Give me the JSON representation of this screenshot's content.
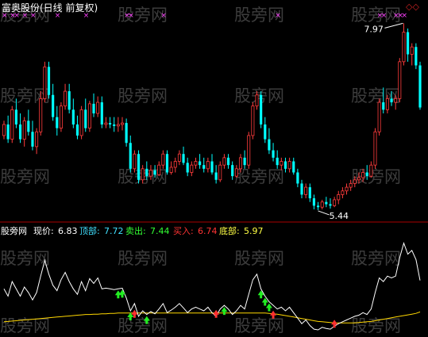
{
  "title": "富奥股份(日线 前复权)",
  "indicator": {
    "name": "股旁网",
    "items": [
      {
        "label": "现价:",
        "value": "6.83",
        "color": "#ffffff"
      },
      {
        "label": "顶部:",
        "value": "7.72",
        "color": "#40e0ff"
      },
      {
        "label": "卖出:",
        "value": "7.44",
        "color": "#33ff33"
      },
      {
        "label": "买入:",
        "value": "6.74",
        "color": "#ff3333"
      },
      {
        "label": "底部:",
        "value": "5.97",
        "color": "#ffff44"
      }
    ]
  },
  "watermark": "股旁网",
  "marker_glyph": "×",
  "top_right_marks": "◇◇",
  "colors": {
    "up": "#ff3c3c",
    "down": "#00ffff",
    "price_line": "#ffffff",
    "bottom_line": "#ffd700",
    "sell_arrow": "#22ee22",
    "buy_arrow": "#ff3030"
  },
  "chart_data": {
    "type": "candlestick",
    "candles": [
      [
        6.45,
        6.65,
        6.4,
        6.6
      ],
      [
        6.6,
        6.72,
        6.35,
        6.4
      ],
      [
        6.4,
        6.85,
        6.35,
        6.8
      ],
      [
        6.8,
        6.95,
        6.55,
        6.6
      ],
      [
        6.6,
        6.75,
        6.35,
        6.4
      ],
      [
        6.4,
        6.7,
        6.3,
        6.65
      ],
      [
        6.65,
        6.8,
        6.45,
        6.5
      ],
      [
        6.5,
        6.65,
        6.25,
        6.3
      ],
      [
        6.3,
        6.55,
        6.2,
        6.5
      ],
      [
        6.5,
        7.05,
        6.45,
        6.95
      ],
      [
        6.95,
        7.45,
        6.9,
        7.38
      ],
      [
        7.38,
        7.45,
        6.95,
        7.0
      ],
      [
        7.0,
        7.15,
        6.65,
        6.7
      ],
      [
        6.7,
        6.85,
        6.45,
        6.55
      ],
      [
        6.55,
        6.9,
        6.5,
        6.85
      ],
      [
        6.85,
        7.15,
        6.8,
        7.05
      ],
      [
        7.05,
        7.15,
        6.75,
        6.8
      ],
      [
        6.8,
        6.95,
        6.55,
        6.6
      ],
      [
        6.6,
        6.72,
        6.4,
        6.45
      ],
      [
        6.45,
        6.85,
        6.4,
        6.8
      ],
      [
        6.8,
        6.95,
        6.5,
        6.55
      ],
      [
        6.55,
        6.92,
        6.5,
        6.88
      ],
      [
        6.88,
        7.02,
        6.7,
        6.75
      ],
      [
        6.75,
        6.98,
        6.7,
        6.9
      ],
      [
        6.9,
        6.98,
        6.55,
        6.6
      ],
      [
        6.6,
        6.7,
        6.55,
        6.62
      ],
      [
        6.62,
        6.7,
        6.55,
        6.6
      ],
      [
        6.6,
        6.7,
        6.5,
        6.58
      ],
      [
        6.58,
        6.7,
        6.5,
        6.6
      ],
      [
        6.6,
        6.7,
        6.52,
        6.62
      ],
      [
        6.62,
        6.68,
        6.3,
        6.35
      ],
      [
        6.35,
        6.45,
        5.95,
        6.0
      ],
      [
        6.0,
        6.25,
        5.95,
        6.2
      ],
      [
        6.2,
        6.25,
        5.8,
        5.85
      ],
      [
        5.85,
        6.05,
        5.8,
        6.0
      ],
      [
        6.0,
        6.1,
        5.85,
        5.9
      ],
      [
        5.9,
        6.05,
        5.85,
        5.98
      ],
      [
        5.98,
        6.05,
        5.88,
        5.92
      ],
      [
        5.92,
        6.1,
        5.9,
        6.05
      ],
      [
        6.05,
        6.25,
        6.0,
        6.2
      ],
      [
        6.2,
        6.25,
        5.92,
        5.95
      ],
      [
        5.95,
        6.1,
        5.92,
        6.02
      ],
      [
        6.02,
        6.15,
        5.95,
        6.1
      ],
      [
        6.1,
        6.25,
        6.05,
        6.2
      ],
      [
        6.2,
        6.3,
        6.05,
        6.08
      ],
      [
        6.08,
        6.15,
        5.9,
        5.95
      ],
      [
        5.95,
        6.1,
        5.9,
        6.05
      ],
      [
        6.05,
        6.15,
        6.0,
        6.1
      ],
      [
        6.1,
        6.2,
        6.0,
        6.05
      ],
      [
        6.05,
        6.15,
        5.95,
        6.0
      ],
      [
        6.0,
        6.15,
        5.95,
        6.1
      ],
      [
        6.1,
        6.2,
        5.92,
        5.95
      ],
      [
        5.95,
        6.05,
        5.8,
        5.85
      ],
      [
        5.85,
        6.1,
        5.82,
        6.05
      ],
      [
        6.05,
        6.2,
        6.0,
        6.15
      ],
      [
        6.15,
        6.2,
        6.0,
        6.05
      ],
      [
        6.05,
        6.1,
        5.85,
        5.9
      ],
      [
        5.9,
        6.05,
        5.88,
        6.0
      ],
      [
        6.0,
        6.2,
        5.95,
        6.15
      ],
      [
        6.15,
        6.25,
        6.0,
        6.05
      ],
      [
        6.05,
        6.5,
        6.0,
        6.45
      ],
      [
        6.45,
        6.9,
        6.4,
        6.85
      ],
      [
        6.85,
        7.05,
        6.8,
        7.0
      ],
      [
        7.0,
        7.05,
        6.55,
        6.6
      ],
      [
        6.6,
        6.7,
        6.35,
        6.4
      ],
      [
        6.4,
        6.55,
        6.2,
        6.25
      ],
      [
        6.25,
        6.35,
        6.1,
        6.15
      ],
      [
        6.15,
        6.25,
        6.0,
        6.05
      ],
      [
        6.05,
        6.15,
        5.98,
        6.1
      ],
      [
        6.1,
        6.15,
        5.95,
        6.0
      ],
      [
        6.0,
        6.15,
        5.95,
        6.1
      ],
      [
        6.1,
        6.15,
        5.92,
        5.95
      ],
      [
        5.95,
        6.0,
        5.75,
        5.8
      ],
      [
        5.8,
        5.85,
        5.6,
        5.65
      ],
      [
        5.65,
        5.8,
        5.6,
        5.75
      ],
      [
        5.75,
        5.8,
        5.55,
        5.6
      ],
      [
        5.6,
        5.65,
        5.45,
        5.5
      ],
      [
        5.5,
        5.55,
        5.44,
        5.48
      ],
      [
        5.48,
        5.58,
        5.45,
        5.55
      ],
      [
        5.55,
        5.62,
        5.48,
        5.52
      ],
      [
        5.52,
        5.6,
        5.46,
        5.5
      ],
      [
        5.5,
        5.62,
        5.48,
        5.58
      ],
      [
        5.58,
        5.7,
        5.52,
        5.65
      ],
      [
        5.65,
        5.75,
        5.6,
        5.7
      ],
      [
        5.7,
        5.8,
        5.65,
        5.75
      ],
      [
        5.75,
        5.85,
        5.7,
        5.8
      ],
      [
        5.8,
        5.9,
        5.75,
        5.85
      ],
      [
        5.85,
        5.95,
        5.8,
        5.88
      ],
      [
        5.88,
        6.0,
        5.82,
        5.95
      ],
      [
        5.95,
        6.05,
        5.85,
        5.9
      ],
      [
        5.9,
        6.1,
        5.88,
        6.05
      ],
      [
        6.05,
        6.55,
        6.0,
        6.5
      ],
      [
        6.5,
        6.95,
        6.45,
        6.9
      ],
      [
        6.9,
        7.1,
        6.75,
        6.8
      ],
      [
        6.8,
        7.0,
        6.75,
        6.95
      ],
      [
        6.95,
        7.05,
        6.85,
        6.9
      ],
      [
        6.9,
        7.0,
        6.8,
        6.95
      ],
      [
        6.95,
        7.5,
        6.9,
        7.45
      ],
      [
        7.45,
        7.97,
        7.4,
        7.85
      ],
      [
        7.85,
        7.9,
        7.45,
        7.55
      ],
      [
        7.55,
        7.7,
        7.4,
        7.65
      ],
      [
        7.65,
        7.7,
        7.35,
        7.4
      ],
      [
        7.4,
        7.45,
        6.8,
        6.83
      ]
    ],
    "annotations": [
      {
        "text": "7.97",
        "candle": 98,
        "type": "high"
      },
      {
        "text": "5.44",
        "candle": 77,
        "type": "low"
      }
    ],
    "indicator_lines": {
      "price": [
        6.6,
        6.4,
        6.8,
        6.6,
        6.4,
        6.65,
        6.5,
        6.3,
        6.5,
        6.95,
        7.38,
        7.0,
        6.7,
        6.55,
        6.85,
        7.05,
        6.8,
        6.6,
        6.45,
        6.8,
        6.55,
        6.88,
        6.75,
        6.9,
        6.6,
        6.62,
        6.6,
        6.58,
        6.6,
        6.62,
        6.35,
        6.0,
        6.2,
        5.85,
        6.0,
        5.9,
        5.98,
        5.92,
        6.05,
        6.2,
        5.95,
        6.02,
        6.1,
        6.2,
        6.08,
        5.95,
        6.05,
        6.1,
        6.05,
        6.0,
        6.1,
        5.95,
        5.85,
        6.05,
        6.15,
        6.05,
        5.9,
        6.0,
        6.15,
        6.05,
        6.45,
        6.85,
        7.0,
        6.6,
        6.4,
        6.25,
        6.15,
        6.05,
        6.1,
        6.0,
        6.1,
        5.95,
        5.8,
        5.65,
        5.75,
        5.6,
        5.5,
        5.48,
        5.55,
        5.52,
        5.5,
        5.58,
        5.65,
        5.7,
        5.75,
        5.8,
        5.85,
        5.88,
        5.95,
        5.9,
        6.05,
        6.5,
        6.9,
        6.8,
        6.95,
        6.9,
        6.95,
        7.45,
        7.85,
        7.55,
        7.65,
        7.4,
        6.83
      ],
      "bottom": [
        5.7,
        5.71,
        5.72,
        5.73,
        5.74,
        5.75,
        5.76,
        5.77,
        5.78,
        5.79,
        5.8,
        5.81,
        5.82,
        5.83,
        5.84,
        5.85,
        5.86,
        5.87,
        5.88,
        5.89,
        5.9,
        5.9,
        5.91,
        5.91,
        5.92,
        5.92,
        5.93,
        5.93,
        5.94,
        5.94,
        5.94,
        5.94,
        5.94,
        5.94,
        5.94,
        5.94,
        5.94,
        5.94,
        5.94,
        5.94,
        5.94,
        5.94,
        5.94,
        5.94,
        5.94,
        5.94,
        5.94,
        5.94,
        5.94,
        5.94,
        5.94,
        5.94,
        5.94,
        5.94,
        5.94,
        5.94,
        5.94,
        5.94,
        5.94,
        5.94,
        5.94,
        5.94,
        5.94,
        5.94,
        5.94,
        5.93,
        5.92,
        5.91,
        5.89,
        5.87,
        5.85,
        5.83,
        5.81,
        5.79,
        5.77,
        5.75,
        5.73,
        5.71,
        5.7,
        5.69,
        5.68,
        5.67,
        5.67,
        5.67,
        5.67,
        5.67,
        5.67,
        5.68,
        5.69,
        5.7,
        5.71,
        5.73,
        5.75,
        5.77,
        5.79,
        5.81,
        5.83,
        5.85,
        5.87,
        5.89,
        5.91,
        5.93,
        5.97
      ]
    },
    "sell_signals": [
      28,
      29,
      31,
      35,
      54,
      63,
      64,
      65
    ],
    "buy_signals": [
      32,
      52,
      66,
      81
    ],
    "top_markers": [
      0,
      2,
      3,
      5,
      7,
      13,
      20,
      30,
      31,
      39,
      67,
      92,
      93,
      96,
      97,
      98
    ]
  }
}
